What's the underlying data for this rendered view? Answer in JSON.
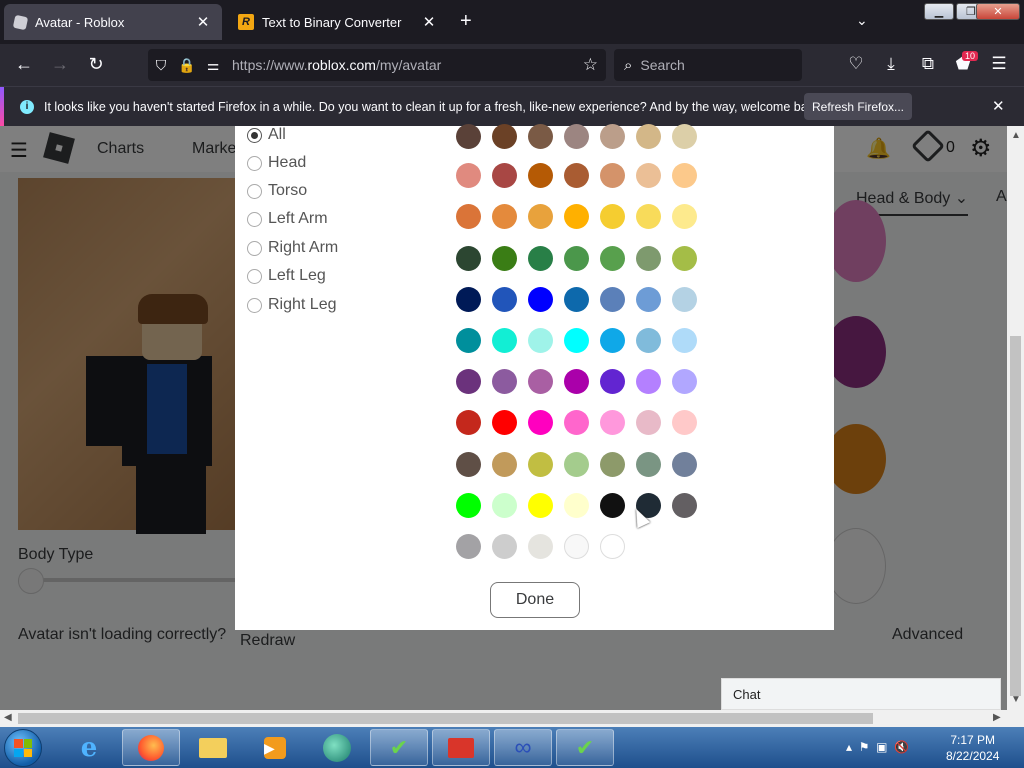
{
  "browser": {
    "tabs": [
      {
        "title": "Avatar - Roblox",
        "active": true
      },
      {
        "title": "Text to Binary Converter",
        "active": false
      }
    ],
    "url_prefix": "https://www.",
    "url_domain": "roblox.com",
    "url_path": "/my/avatar",
    "search_placeholder": "Search",
    "extension_badge": "10",
    "notification": {
      "message": "It looks like you haven't started Firefox in a while. Do you want to clean it up for a fresh, like-new experience? And by the way, welcome back!",
      "button": "Refresh Firefox..."
    }
  },
  "roblox": {
    "nav": [
      "Charts",
      "Marke"
    ],
    "robux": "0",
    "tab_head_body": "Head & Body",
    "tab_next": "A",
    "body_type": "Body Type",
    "not_loading": "Avatar isn't loading correctly?",
    "redraw": "Redraw",
    "advanced": "Advanced",
    "chat": "Chat"
  },
  "modal": {
    "body_parts": [
      {
        "label": "All",
        "selected": true
      },
      {
        "label": "Head",
        "selected": false
      },
      {
        "label": "Torso",
        "selected": false
      },
      {
        "label": "Left Arm",
        "selected": false
      },
      {
        "label": "Right Arm",
        "selected": false
      },
      {
        "label": "Left Leg",
        "selected": false
      },
      {
        "label": "Right Leg",
        "selected": false
      }
    ],
    "colors": [
      [
        "#5a4138",
        "#6b4126",
        "#7a5a45",
        "#9c8581",
        "#bb9e8a",
        "#d3b788",
        "#dccfa8"
      ],
      [
        "#e08a7f",
        "#a84744",
        "#b55a05",
        "#a95c32",
        "#d4936a",
        "#ebbf96",
        "#fcc98b"
      ],
      [
        "#da7438",
        "#e48a3c",
        "#e8a23c",
        "#ffb000",
        "#f5cd30",
        "#f8db5a",
        "#fdea8d"
      ],
      [
        "#2c4631",
        "#3a7d15",
        "#287f47",
        "#4b974b",
        "#58a04d",
        "#7e9a6e",
        "#a4bd47"
      ],
      [
        "#001a57",
        "#2155ba",
        "#0000ff",
        "#0d69ac",
        "#5b80b9",
        "#6d9cd6",
        "#b4d2e4"
      ],
      [
        "#008f9c",
        "#12eed4",
        "#9ff3e9",
        "#00ffff",
        "#0fa8e8",
        "#80bbdb",
        "#afdbf9"
      ],
      [
        "#6b327c",
        "#8c5b9f",
        "#a95fa3",
        "#aa00aa",
        "#6225d1",
        "#b480ff",
        "#b1a7ff"
      ],
      [
        "#c4281c",
        "#ff0000",
        "#ff00bf",
        "#ff66cc",
        "#ff98dc",
        "#e8bac8",
        "#ffc9c9"
      ],
      [
        "#5f4f46",
        "#c19a5b",
        "#c1be42",
        "#a4cc8d",
        "#8d9a6a",
        "#7a9583",
        "#71809b"
      ],
      [
        "#00ff00",
        "#ccffcc",
        "#ffff00",
        "#ffffcc",
        "#111111",
        "#1f2b35",
        "#635f62"
      ],
      [
        "#a3a2a5",
        "#cdcdcd",
        "#e5e4df",
        "#f8f8f8",
        "#ffffff"
      ]
    ],
    "done": "Done"
  },
  "taskbar": {
    "time": "7:17 PM",
    "date": "8/22/2024"
  }
}
